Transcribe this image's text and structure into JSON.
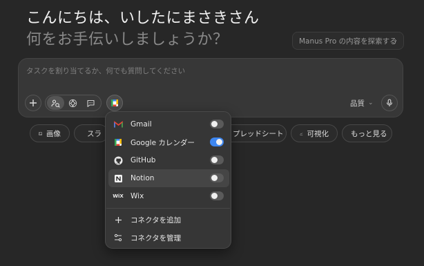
{
  "greeting": {
    "line1": "こんにちは、いしたにまさきさん",
    "line2": "何をお手伝いしましょうか？"
  },
  "pro_banner": {
    "label": "Manus Pro の内容を探索する",
    "chevron_icon": "chevron-right-icon"
  },
  "composer": {
    "placeholder": "タスクを割り当てるか、何でも質問してください",
    "quality_label": "品質",
    "mode_buttons": [
      "agent-mode-icon",
      "sparkle-mode-icon",
      "chat-mode-icon"
    ]
  },
  "chips": [
    {
      "label": "画像",
      "icon": "image-icon"
    },
    {
      "label": "スラ",
      "icon": "slides-icon"
    },
    {
      "label": "プレッドシート",
      "icon": ""
    },
    {
      "label": "可視化",
      "icon": "chart-icon"
    },
    {
      "label": "もっと見る",
      "icon": ""
    }
  ],
  "connectors_menu": {
    "items": [
      {
        "label": "Gmail",
        "icon": "gmail-icon",
        "enabled": false
      },
      {
        "label": "Google カレンダー",
        "icon": "google-calendar-icon",
        "enabled": true
      },
      {
        "label": "GitHub",
        "icon": "github-icon",
        "enabled": false
      },
      {
        "label": "Notion",
        "icon": "notion-icon",
        "enabled": false
      },
      {
        "label": "Wix",
        "icon": "wix-icon",
        "enabled": false
      }
    ],
    "actions": [
      {
        "label": "コネクタを追加",
        "icon": "plus-icon"
      },
      {
        "label": "コネクタを管理",
        "icon": "manage-connectors-icon"
      }
    ]
  },
  "colors": {
    "background": "#272727",
    "toggle_on": "#3d86f0",
    "calendar_blue": "#4285f4"
  }
}
